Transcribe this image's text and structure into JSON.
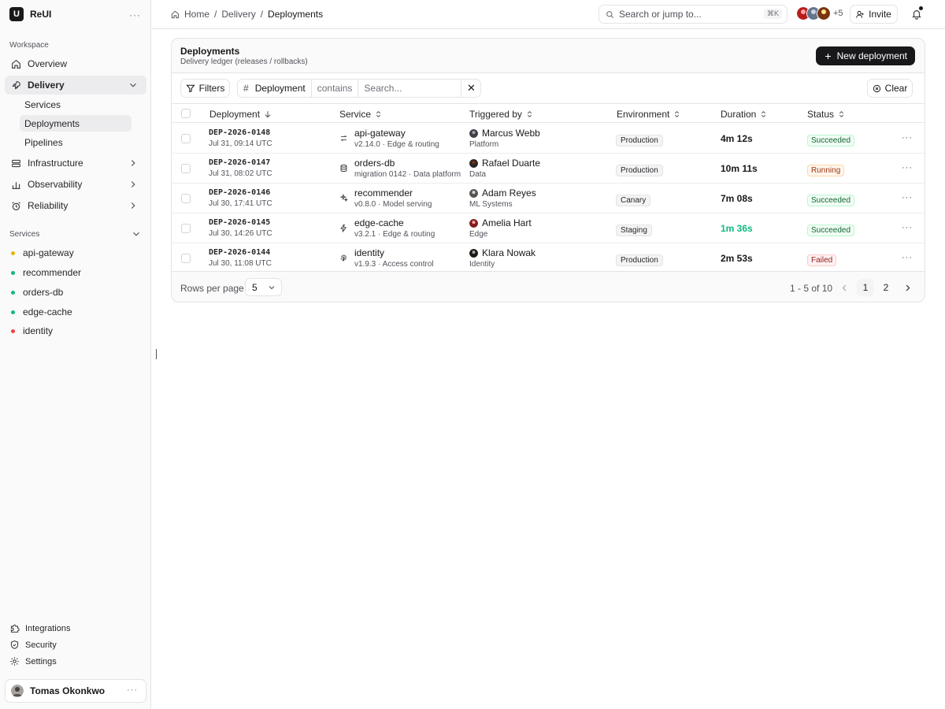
{
  "brand": {
    "name": "ReUI",
    "logo": "U"
  },
  "sidebar": {
    "workspace_label": "Workspace",
    "nav": [
      {
        "label": "Overview",
        "icon": "home-icon"
      },
      {
        "label": "Delivery",
        "icon": "rocket-icon",
        "active": true,
        "expanded": true,
        "children": [
          {
            "label": "Services"
          },
          {
            "label": "Deployments",
            "active": true
          },
          {
            "label": "Pipelines"
          }
        ]
      },
      {
        "label": "Infrastructure",
        "icon": "database-icon"
      },
      {
        "label": "Observability",
        "icon": "bar-chart-icon"
      },
      {
        "label": "Reliability",
        "icon": "alarm-icon"
      }
    ],
    "services_label": "Services",
    "services": [
      {
        "label": "api-gateway",
        "color": "#eab308"
      },
      {
        "label": "recommender",
        "color": "#10b981"
      },
      {
        "label": "orders-db",
        "color": "#10b981"
      },
      {
        "label": "edge-cache",
        "color": "#10b981"
      },
      {
        "label": "identity",
        "color": "#ef4444"
      }
    ],
    "footer": [
      {
        "label": "Integrations",
        "icon": "puzzle-icon"
      },
      {
        "label": "Security",
        "icon": "shield-icon"
      },
      {
        "label": "Settings",
        "icon": "gear-icon"
      }
    ],
    "user": {
      "name": "Tomas Okonkwo"
    }
  },
  "topbar": {
    "breadcrumbs": [
      "Home",
      "Delivery",
      "Deployments"
    ],
    "search_placeholder": "Search or jump to...",
    "search_shortcut": "⌘K",
    "avatars_more": "+5",
    "invite_label": "Invite"
  },
  "card": {
    "title": "Deployments",
    "subtitle": "Delivery ledger (releases / rollbacks)",
    "new_button": "New deployment",
    "filters_label": "Filters",
    "filter_field": "Deployment",
    "filter_operator": "contains",
    "filter_placeholder": "Search...",
    "clear_label": "Clear"
  },
  "table": {
    "columns": [
      "Deployment",
      "Service",
      "Triggered by",
      "Environment",
      "Duration",
      "Status"
    ],
    "rows": [
      {
        "id": "DEP-2026-0148",
        "time": "Jul 31, 09:14 UTC",
        "service": "api-gateway",
        "service_icon": "arrows-swap-icon",
        "service_meta": "v2.14.0 · Edge & routing",
        "user": "Marcus Webb",
        "team": "Platform",
        "env": "Production",
        "duration": "4m 12s",
        "duration_color": "#18181b",
        "status": "Succeeded",
        "status_kind": "ok"
      },
      {
        "id": "DEP-2026-0147",
        "time": "Jul 31, 08:02 UTC",
        "service": "orders-db",
        "service_icon": "database-icon",
        "service_meta": "migration 0142 · Data platform",
        "user": "Rafael Duarte",
        "team": "Data",
        "env": "Production",
        "duration": "10m 11s",
        "duration_color": "#18181b",
        "status": "Running",
        "status_kind": "run"
      },
      {
        "id": "DEP-2026-0146",
        "time": "Jul 30, 17:41 UTC",
        "service": "recommender",
        "service_icon": "sparkles-icon",
        "service_meta": "v0.8.0 · Model serving",
        "user": "Adam Reyes",
        "team": "ML Systems",
        "env": "Canary",
        "duration": "7m 08s",
        "duration_color": "#18181b",
        "status": "Succeeded",
        "status_kind": "ok"
      },
      {
        "id": "DEP-2026-0145",
        "time": "Jul 30, 14:26 UTC",
        "service": "edge-cache",
        "service_icon": "bolt-icon",
        "service_meta": "v3.2.1 · Edge & routing",
        "user": "Amelia Hart",
        "team": "Edge",
        "env": "Staging",
        "duration": "1m 36s",
        "duration_color": "#10b981",
        "status": "Succeeded",
        "status_kind": "ok"
      },
      {
        "id": "DEP-2026-0144",
        "time": "Jul 30, 11:08 UTC",
        "service": "identity",
        "service_icon": "fingerprint-icon",
        "service_meta": "v1.9.3 · Access control",
        "user": "Klara Nowak",
        "team": "Identity",
        "env": "Production",
        "duration": "2m 53s",
        "duration_color": "#18181b",
        "status": "Failed",
        "status_kind": "fail"
      }
    ]
  },
  "pagination": {
    "rows_per_page_label": "Rows per page",
    "rows_per_page": "5",
    "range": "1 - 5 of 10",
    "pages": [
      "1",
      "2"
    ],
    "current_page": "1"
  }
}
